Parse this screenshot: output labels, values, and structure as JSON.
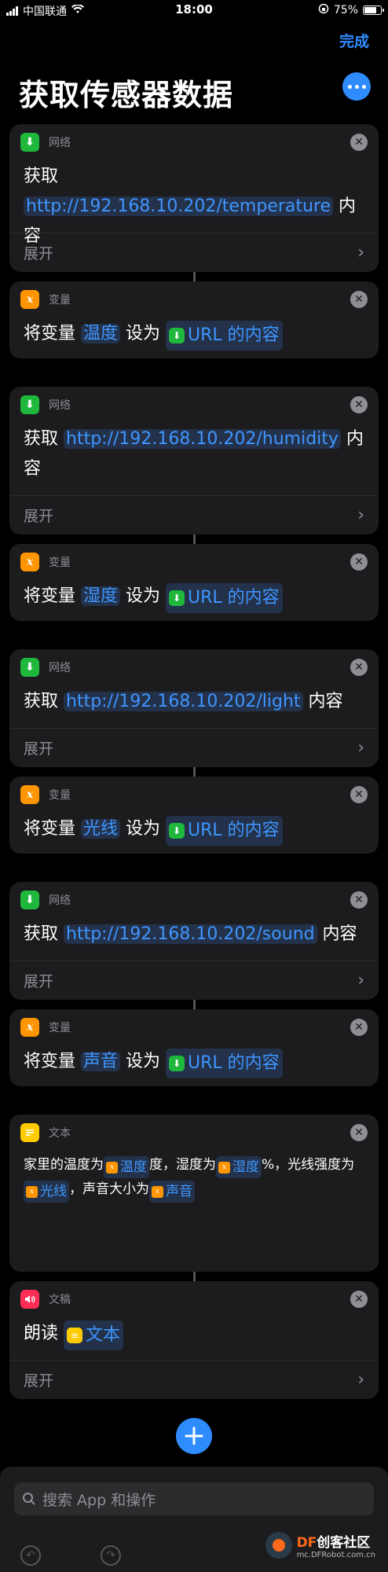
{
  "status": {
    "carrier": "中国联通",
    "time": "18:00",
    "battery": "75%",
    "battery_level": 0.75
  },
  "nav": {
    "done": "完成",
    "title": "获取传感器数据"
  },
  "colors": {
    "accent": "#2e8cff",
    "network": "#1fb83c",
    "variable": "#ff9500",
    "text": "#ffcc00",
    "speak": "#ff2d55"
  },
  "cards": [
    {
      "type": "网络",
      "verb": "获取",
      "url": "http://192.168.10.202/temperature",
      "suffix": "内容",
      "expand": "展开"
    },
    {
      "type": "变量",
      "verb": "将变量",
      "var": "温度",
      "mid": "设为",
      "value": "URL 的内容"
    },
    {
      "type": "网络",
      "verb": "获取",
      "url": "http://192.168.10.202/humidity",
      "suffix": "内容",
      "expand": "展开"
    },
    {
      "type": "变量",
      "verb": "将变量",
      "var": "湿度",
      "mid": "设为",
      "value": "URL 的内容"
    },
    {
      "type": "网络",
      "verb": "获取",
      "url": "http://192.168.10.202/light",
      "suffix": "内容",
      "expand": "展开"
    },
    {
      "type": "变量",
      "verb": "将变量",
      "var": "光线",
      "mid": "设为",
      "value": "URL 的内容"
    },
    {
      "type": "网络",
      "verb": "获取",
      "url": "http://192.168.10.202/sound",
      "suffix": "内容",
      "expand": "展开"
    },
    {
      "type": "变量",
      "verb": "将变量",
      "var": "声音",
      "mid": "设为",
      "value": "URL 的内容"
    }
  ],
  "text_card": {
    "type": "文本",
    "p1": "家里的温度为",
    "v1": "温度",
    "p2": "度，湿度为",
    "v2": "湿度",
    "p3": "%，光线强度为",
    "v3": "光线",
    "p4": "，声音大小为",
    "v4": "声音"
  },
  "speak_card": {
    "type": "文稿",
    "verb": "朗读",
    "value": "文本",
    "expand": "展开"
  },
  "bottom": {
    "search_placeholder": "搜索 App 和操作"
  },
  "watermark": {
    "df": "DF",
    "name": "创客社区",
    "site": "mc.DFRobot.com.cn"
  },
  "icons": {
    "network": "download-arrow-icon",
    "variable": "variable-x-icon",
    "text": "text-lines-icon",
    "speak": "speaker-icon"
  }
}
